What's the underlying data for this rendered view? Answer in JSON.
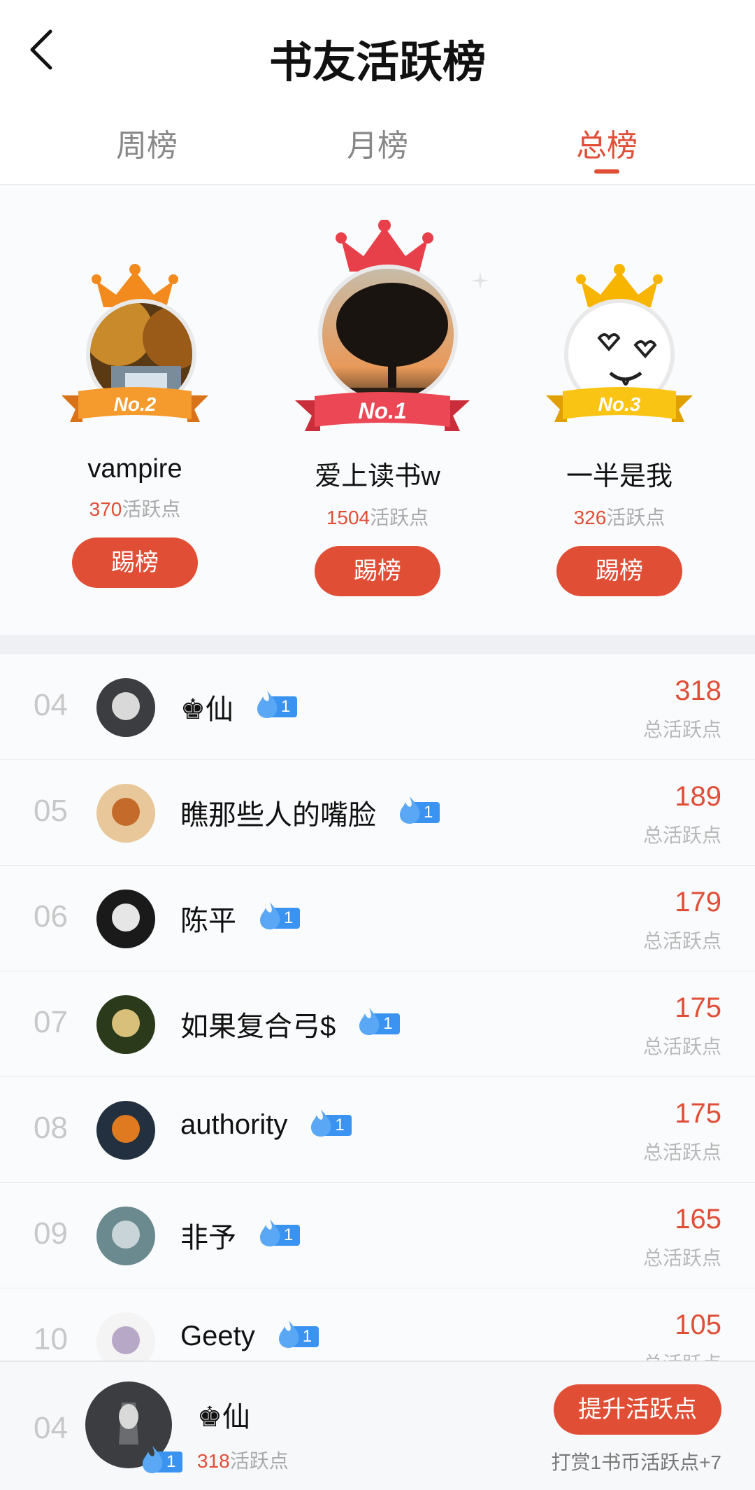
{
  "header": {
    "title": "书友活跃榜"
  },
  "tabs": [
    {
      "label": "周榜",
      "active": false
    },
    {
      "label": "月榜",
      "active": false
    },
    {
      "label": "总榜",
      "active": true
    }
  ],
  "podium": [
    {
      "rank_label": "No.2",
      "name": "vampire",
      "points": "370",
      "points_suffix": "活跃点",
      "button": "踢榜"
    },
    {
      "rank_label": "No.1",
      "name": "爱上读书w",
      "points": "1504",
      "points_suffix": "活跃点",
      "button": "踢榜"
    },
    {
      "rank_label": "No.3",
      "name": "一半是我",
      "points": "326",
      "points_suffix": "活跃点",
      "button": "踢榜"
    }
  ],
  "list": [
    {
      "rank": "04",
      "name": "♚仙",
      "level": "1",
      "score": "318",
      "score_label": "总活跃点"
    },
    {
      "rank": "05",
      "name": "瞧那些人的嘴脸",
      "level": "1",
      "score": "189",
      "score_label": "总活跃点"
    },
    {
      "rank": "06",
      "name": "陈平",
      "level": "1",
      "score": "179",
      "score_label": "总活跃点"
    },
    {
      "rank": "07",
      "name": "如果复合弓$",
      "level": "1",
      "score": "175",
      "score_label": "总活跃点"
    },
    {
      "rank": "08",
      "name": "authority",
      "level": "1",
      "score": "175",
      "score_label": "总活跃点"
    },
    {
      "rank": "09",
      "name": "非予",
      "level": "1",
      "score": "165",
      "score_label": "总活跃点"
    },
    {
      "rank": "10",
      "name": "Geety",
      "level": "1",
      "score": "105",
      "score_label": "总活跃点"
    }
  ],
  "footer": {
    "rank": "04",
    "name": "♚仙",
    "level": "1",
    "points": "318",
    "points_suffix": "活跃点",
    "button": "提升活跃点",
    "note": "打赏1书币活跃点+7"
  },
  "colors": {
    "accent": "#e04e36",
    "badge_blue": "#3a93f0",
    "gold": "#f7b500",
    "orange": "#f28a1d",
    "red_crown": "#e8404a"
  }
}
